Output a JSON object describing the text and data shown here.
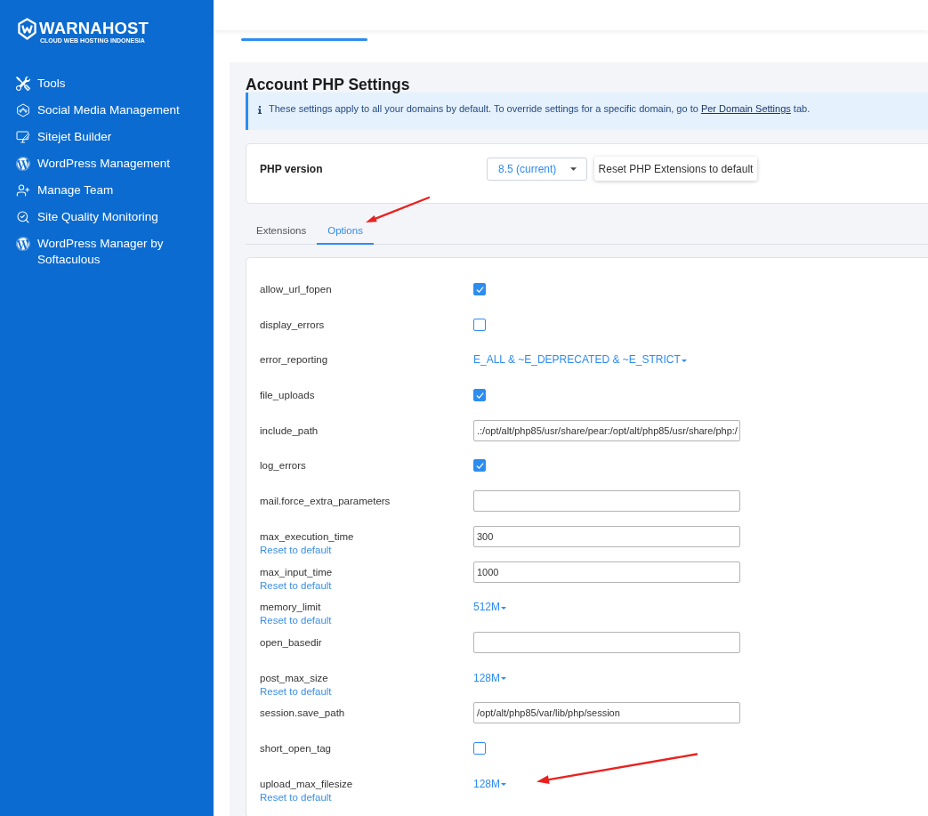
{
  "sidebar": {
    "logo": {
      "name": "WARNAHOST",
      "tagline": "CLOUD WEB HOSTING INDONESIA"
    },
    "items": [
      {
        "label": "Tools",
        "kind": "tools"
      },
      {
        "label": "Social Media Management",
        "kind": "social"
      },
      {
        "label": "Sitejet Builder",
        "kind": "sitejet"
      },
      {
        "label": "WordPress Management",
        "kind": "wordpress"
      },
      {
        "label": "Manage Team",
        "kind": "team"
      },
      {
        "label": "Site Quality Monitoring",
        "kind": "monitoring"
      },
      {
        "label": "WordPress Manager by Softaculous",
        "kind": "wordpress"
      }
    ]
  },
  "page": {
    "title": "Account PHP Settings",
    "info": {
      "text": "These settings apply to all your domains by default. To override settings for a specific domain, go to",
      "link": "Per Domain Settings",
      "text_after": "tab."
    },
    "php_version": {
      "label": "PHP version",
      "value": "8.5 (current)",
      "button": "Reset PHP Extensions to default"
    },
    "tabs": [
      {
        "label": "Extensions",
        "selected": false
      },
      {
        "label": "Options",
        "selected": true
      }
    ],
    "options": [
      {
        "name": "allow_url_fopen",
        "kind": "checkbox",
        "checked": true
      },
      {
        "name": "display_errors",
        "kind": "checkbox",
        "checked": false
      },
      {
        "name": "error_reporting",
        "kind": "dropdown",
        "value": "E_ALL & ~E_DEPRECATED & ~E_STRICT"
      },
      {
        "name": "file_uploads",
        "kind": "checkbox",
        "checked": true
      },
      {
        "name": "include_path",
        "kind": "text",
        "value": ".:/opt/alt/php85/usr/share/pear:/opt/alt/php85/usr/share/php:/"
      },
      {
        "name": "log_errors",
        "kind": "checkbox",
        "checked": true
      },
      {
        "name": "mail.force_extra_parameters",
        "kind": "text"
      },
      {
        "name": "max_execution_time",
        "kind": "text",
        "value": "300",
        "reset": "Reset to default"
      },
      {
        "name": "max_input_time",
        "kind": "text",
        "value": "1000",
        "reset": "Reset to default"
      },
      {
        "name": "memory_limit",
        "kind": "dropdown",
        "value": "512M",
        "reset": "Reset to default"
      },
      {
        "name": "open_basedir",
        "kind": "text"
      },
      {
        "name": "post_max_size",
        "kind": "dropdown",
        "value": "128M",
        "reset": "Reset to default"
      },
      {
        "name": "session.save_path",
        "kind": "text",
        "value": "/opt/alt/php85/var/lib/php/session"
      },
      {
        "name": "short_open_tag",
        "kind": "checkbox",
        "checked": false
      },
      {
        "name": "upload_max_filesize",
        "kind": "dropdown",
        "value": "128M",
        "reset": "Reset to default"
      }
    ]
  }
}
